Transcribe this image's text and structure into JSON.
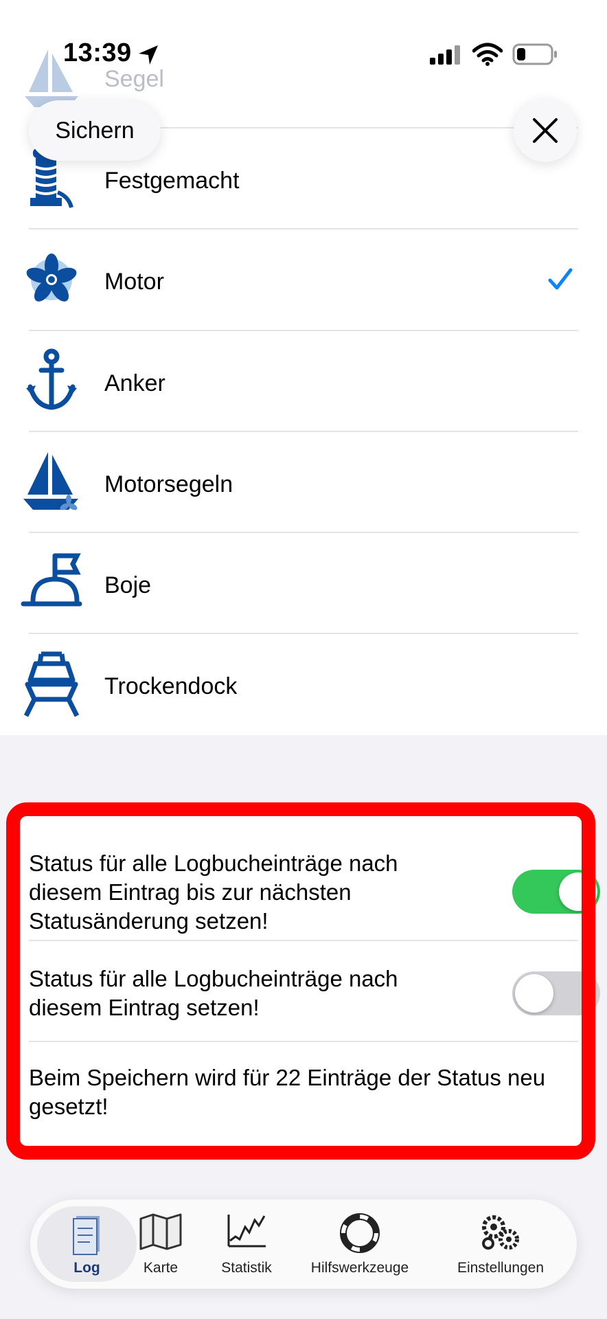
{
  "status_bar": {
    "time": "13:39"
  },
  "toolbar": {
    "save_label": "Sichern"
  },
  "states": [
    {
      "label": "Segel"
    },
    {
      "label": "Festgemacht"
    },
    {
      "label": "Motor",
      "selected": true
    },
    {
      "label": "Anker"
    },
    {
      "label": "Motorsegeln"
    },
    {
      "label": "Boje"
    },
    {
      "label": "Trockendock"
    }
  ],
  "settings": {
    "option1": {
      "text": "Status für alle Logbucheinträge nach diesem Eintrag bis zur nächsten Statusänderung setzen!",
      "enabled": true
    },
    "option2": {
      "text": "Status für alle Logbucheinträge nach diesem Eintrag setzen!",
      "enabled": false
    },
    "info": "Beim Speichern wird für 22 Einträge der Status neu gesetzt!"
  },
  "tabs": [
    {
      "label": "Log",
      "active": true
    },
    {
      "label": "Karte"
    },
    {
      "label": "Statistik"
    },
    {
      "label": "Hilfswerkzeuge"
    },
    {
      "label": "Einstellungen"
    }
  ],
  "colors": {
    "accent": "#0a84ff",
    "icon_blue": "#0b4d9e",
    "toggle_on": "#34c759",
    "highlight": "#ff0000"
  }
}
